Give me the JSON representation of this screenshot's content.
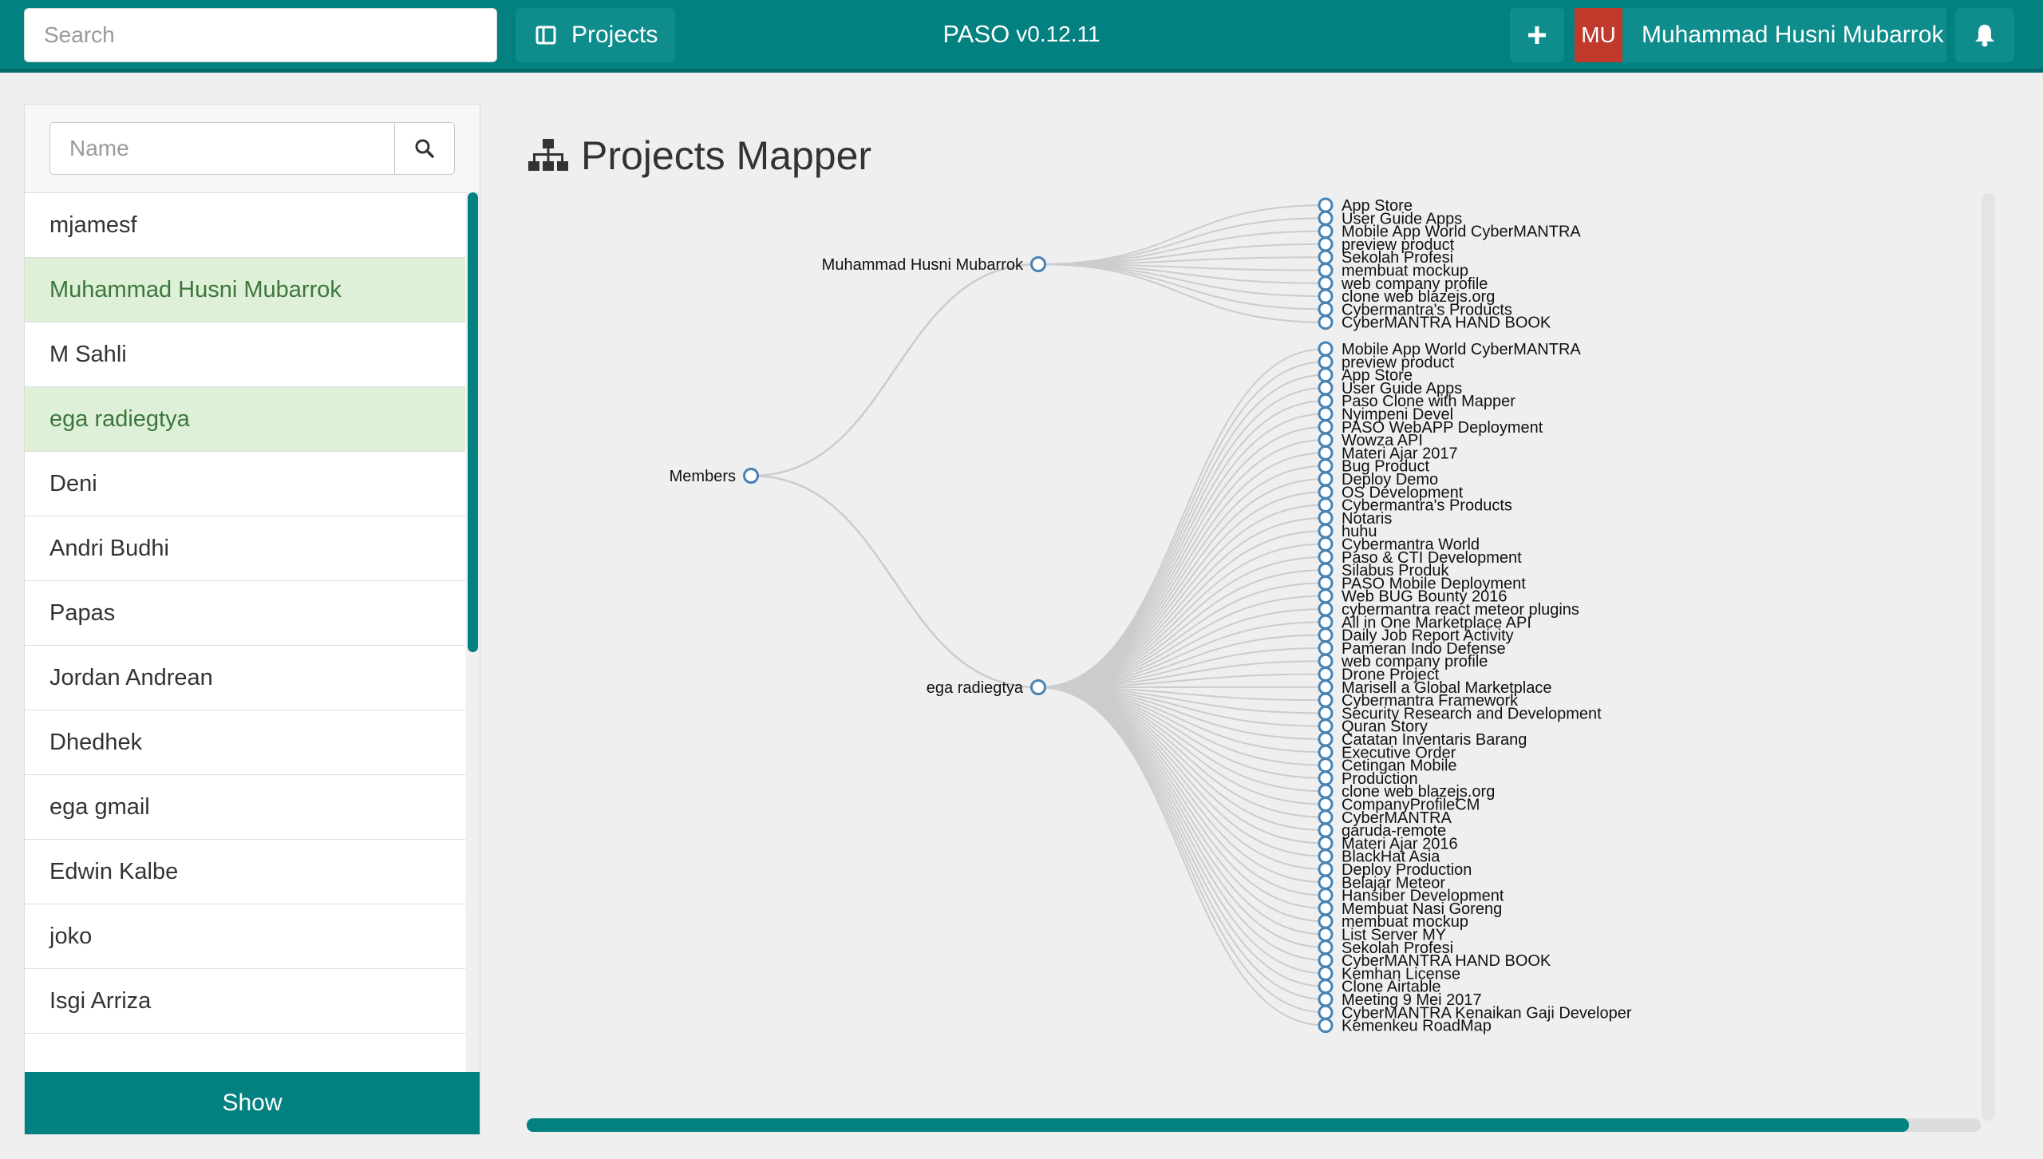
{
  "header": {
    "search_placeholder": "Search",
    "projects_label": "Projects",
    "app_name": "PASO",
    "version": "v0.12.11",
    "avatar_initials": "MU",
    "user_name": "Muhammad Husni Mubarrok",
    "icons": {
      "projects": "columns-icon",
      "add": "plus-icon",
      "notifications": "bell-icon"
    },
    "colors": {
      "bar": "#038181",
      "avatar": "#c0392b"
    }
  },
  "sidebar": {
    "name_placeholder": "Name",
    "search_icon": "search-icon",
    "members": [
      {
        "name": "mjamesf",
        "selected": false
      },
      {
        "name": "Muhammad Husni Mubarrok",
        "selected": true
      },
      {
        "name": "M Sahli",
        "selected": false
      },
      {
        "name": "ega radiegtya",
        "selected": true
      },
      {
        "name": "Deni",
        "selected": false
      },
      {
        "name": "Andri Budhi",
        "selected": false
      },
      {
        "name": "Papas",
        "selected": false
      },
      {
        "name": "Jordan Andrean",
        "selected": false
      },
      {
        "name": "Dhedhek",
        "selected": false
      },
      {
        "name": "ega gmail",
        "selected": false
      },
      {
        "name": "Edwin Kalbe",
        "selected": false
      },
      {
        "name": "joko",
        "selected": false
      },
      {
        "name": "Isgi Arriza",
        "selected": false
      },
      {
        "name": "",
        "selected": false
      }
    ],
    "show_label": "Show"
  },
  "main": {
    "title": "Projects Mapper",
    "title_icon": "sitemap-icon",
    "tree": {
      "root": "Members",
      "members": [
        {
          "name": "Muhammad Husni Mubarrok",
          "projects": [
            "App Store",
            "User Guide Apps",
            "Mobile App World CyberMANTRA",
            "preview product",
            "Sekolah Profesi",
            "membuat mockup",
            "web company profile",
            "clone web blazejs.org",
            "Cybermantra's Products",
            "CyberMANTRA HAND BOOK"
          ]
        },
        {
          "name": "ega radiegtya",
          "projects": [
            "Mobile App World CyberMANTRA",
            "preview product",
            "App Store",
            "User Guide Apps",
            "Paso Clone with Mapper",
            "Nyimpeni Devel",
            "PASO WebAPP Deployment",
            "Wowza API",
            "Materi Ajar 2017",
            "Bug Product",
            "Deploy Demo",
            "OS Development",
            "Cybermantra's Products",
            "Notaris",
            "huhu",
            "Cybermantra World",
            "Paso & CTI Development",
            "Silabus Produk",
            "PASO Mobile Deployment",
            "Web BUG Bounty 2016",
            "cybermantra react meteor plugins",
            "All in One Marketplace API",
            "Daily Job Report Activity",
            "Pameran Indo Defense",
            "web company profile",
            "Drone Project",
            "Marisell a Global Marketplace",
            "Cybermantra Framework",
            "Security Research and Development",
            "Quran Story",
            "Catatan Inventaris Barang",
            "Executive Order",
            "Cetingan Mobile",
            "Production",
            "clone web blazejs.org",
            "CompanyProfileCM",
            "CyberMANTRA",
            "garuda-remote",
            "Materi Ajar 2016",
            "BlackHat Asia",
            "Deploy Production",
            "Belajar Meteor",
            "Hansiber Development",
            "Membuat Nasi Goreng",
            "membuat mockup",
            "List Server MY",
            "Sekolah Profesi",
            "CyberMANTRA HAND BOOK",
            "Kemhan License",
            "Clone Airtable",
            "Meeting 9 Mei 2017",
            "CyberMANTRA Kenaikan Gaji Developer",
            "Kemenkeu RoadMap"
          ]
        }
      ],
      "colors": {
        "node_stroke": "#4682b4",
        "link": "#cccccc"
      }
    }
  }
}
